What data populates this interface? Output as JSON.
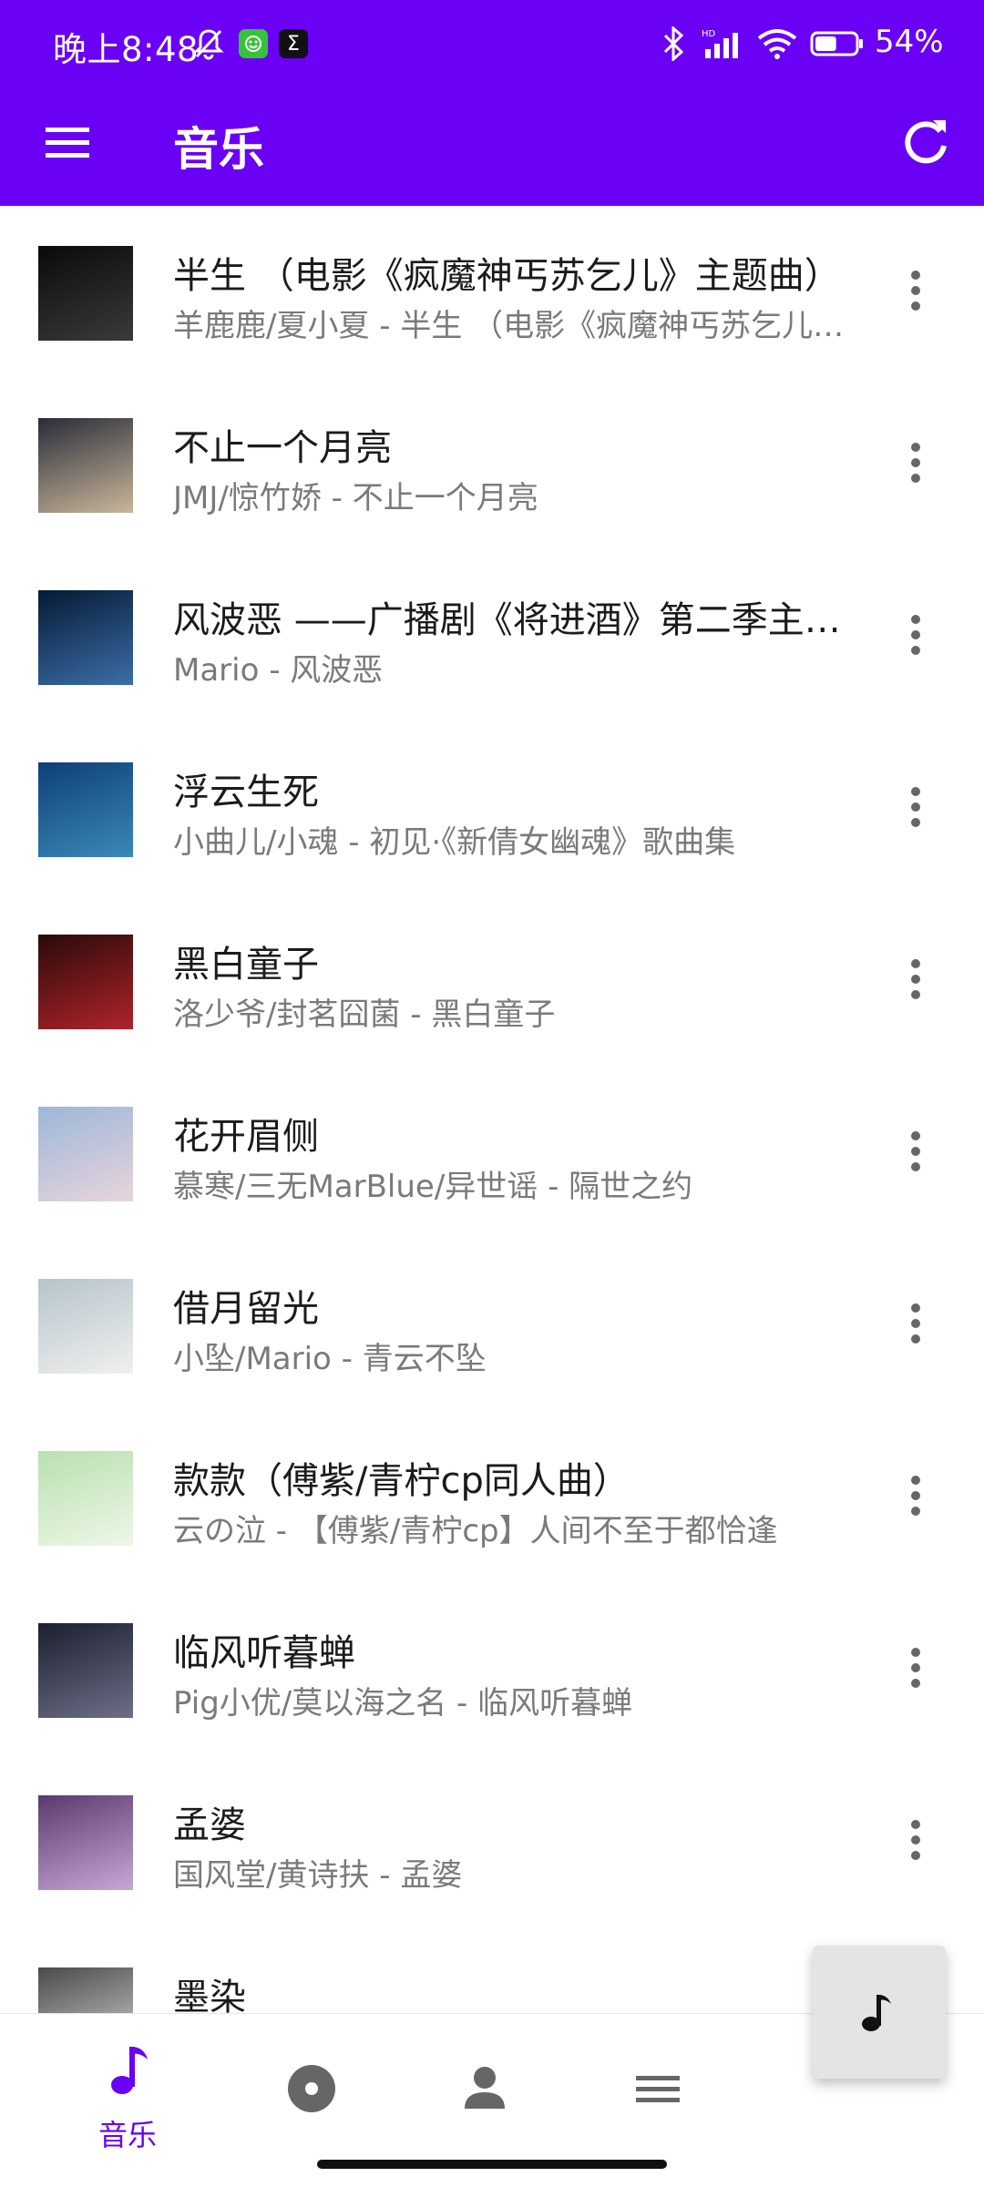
{
  "status": {
    "time": "晚上8:48",
    "app_icon_2": "Σ",
    "battery_percent": "54%",
    "battery_level": 0.54
  },
  "appbar": {
    "title": "音乐"
  },
  "songs": [
    {
      "title": "半生 （电影《疯魔神丐苏乞儿》主题曲）",
      "subtitle": "羊鹿鹿/夏小夏 - 半生 （电影《疯魔神丐苏乞儿》主题曲）",
      "cover_colors": [
        "#0a0a0a",
        "#3a3a3a"
      ]
    },
    {
      "title": "不止一个月亮",
      "subtitle": "JMJ/惊竹娇 - 不止一个月亮",
      "cover_colors": [
        "#2a2c3a",
        "#c9b79a"
      ]
    },
    {
      "title": "风波恶 ——广播剧《将进酒》第二季主题曲",
      "subtitle": "Mario - 风波恶",
      "cover_colors": [
        "#061a34",
        "#3b6ea8"
      ]
    },
    {
      "title": "浮云生死",
      "subtitle": "小曲儿/小魂 - 初见·《新倩女幽魂》歌曲集",
      "cover_colors": [
        "#0e3f78",
        "#3b89b8"
      ]
    },
    {
      "title": "黑白童子",
      "subtitle": "洛少爷/封茗囧菌 - 黑白童子",
      "cover_colors": [
        "#2a0a0a",
        "#b0232a"
      ]
    },
    {
      "title": "花开眉侧",
      "subtitle": "慕寒/三无MarBlue/异世谣 - 隔世之约",
      "cover_colors": [
        "#9db7d8",
        "#e8d4dc"
      ]
    },
    {
      "title": "借月留光",
      "subtitle": "小坠/Mario - 青云不坠",
      "cover_colors": [
        "#b6c4cc",
        "#f0f0ee"
      ]
    },
    {
      "title": "款款（傅紫/青柠cp同人曲）",
      "subtitle": "云の泣 - 【傅紫/青柠cp】人间不至于都恰逢",
      "cover_colors": [
        "#b9e0b0",
        "#eef7e8"
      ]
    },
    {
      "title": "临风听暮蝉",
      "subtitle": "Pig小优/莫以海之名 - 临风听暮蝉",
      "cover_colors": [
        "#1b1f2e",
        "#6d6f88"
      ]
    },
    {
      "title": "孟婆",
      "subtitle": "国风堂/黄诗扶 - 孟婆",
      "cover_colors": [
        "#5a3a6e",
        "#c9a6d8"
      ]
    },
    {
      "title": "墨染",
      "subtitle": "",
      "cover_colors": [
        "#4a4a4a",
        "#d8d8d8"
      ]
    }
  ],
  "bottom_nav": {
    "items": [
      {
        "icon": "music-note-icon",
        "label": "音乐",
        "active": true
      },
      {
        "icon": "disc-icon",
        "label": "",
        "active": false
      },
      {
        "icon": "person-icon",
        "label": "",
        "active": false
      },
      {
        "icon": "menu-icon",
        "label": "",
        "active": false
      }
    ]
  },
  "colors": {
    "primary": "#6a00f4",
    "inactive": "#666666"
  }
}
